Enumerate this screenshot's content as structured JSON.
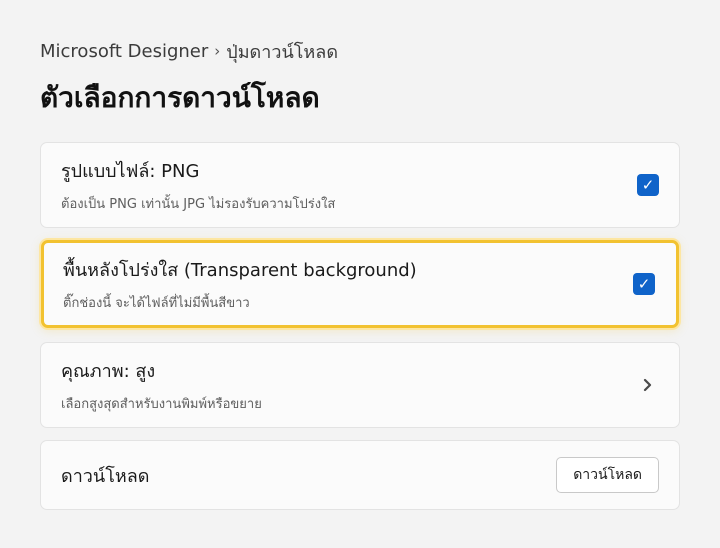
{
  "breadcrumb": {
    "app": "Microsoft Designer",
    "separator": "›",
    "current": "ปุ่มดาวน์โหลด"
  },
  "page_title": "ตัวเลือกการดาวน์โหลด",
  "options": {
    "file_type": {
      "label": "รูปแบบไฟล์: PNG",
      "description": "ต้องเป็น PNG เท่านั้น JPG ไม่รองรับความโปร่งใส",
      "checked": true,
      "check_glyph": "✓"
    },
    "transparent_bg": {
      "label": "พื้นหลังโปร่งใส (Transparent background)",
      "description": "ติ๊กช่องนี้ จะได้ไฟล์ที่ไม่มีพื้นสีขาว",
      "checked": true,
      "check_glyph": "✓",
      "highlight_color": "#f2c230"
    },
    "quality": {
      "label": "คุณภาพ: สูง",
      "description": "เลือกสูงสุดสำหรับงานพิมพ์หรือขยาย",
      "icon": "chevron-right-icon"
    }
  },
  "download": {
    "label": "ดาวน์โหลด",
    "button_label": "ดาวน์โหลด"
  },
  "colors": {
    "accent": "#0f63c9",
    "background": "#f3f3f3",
    "card": "#fbfbfb"
  }
}
